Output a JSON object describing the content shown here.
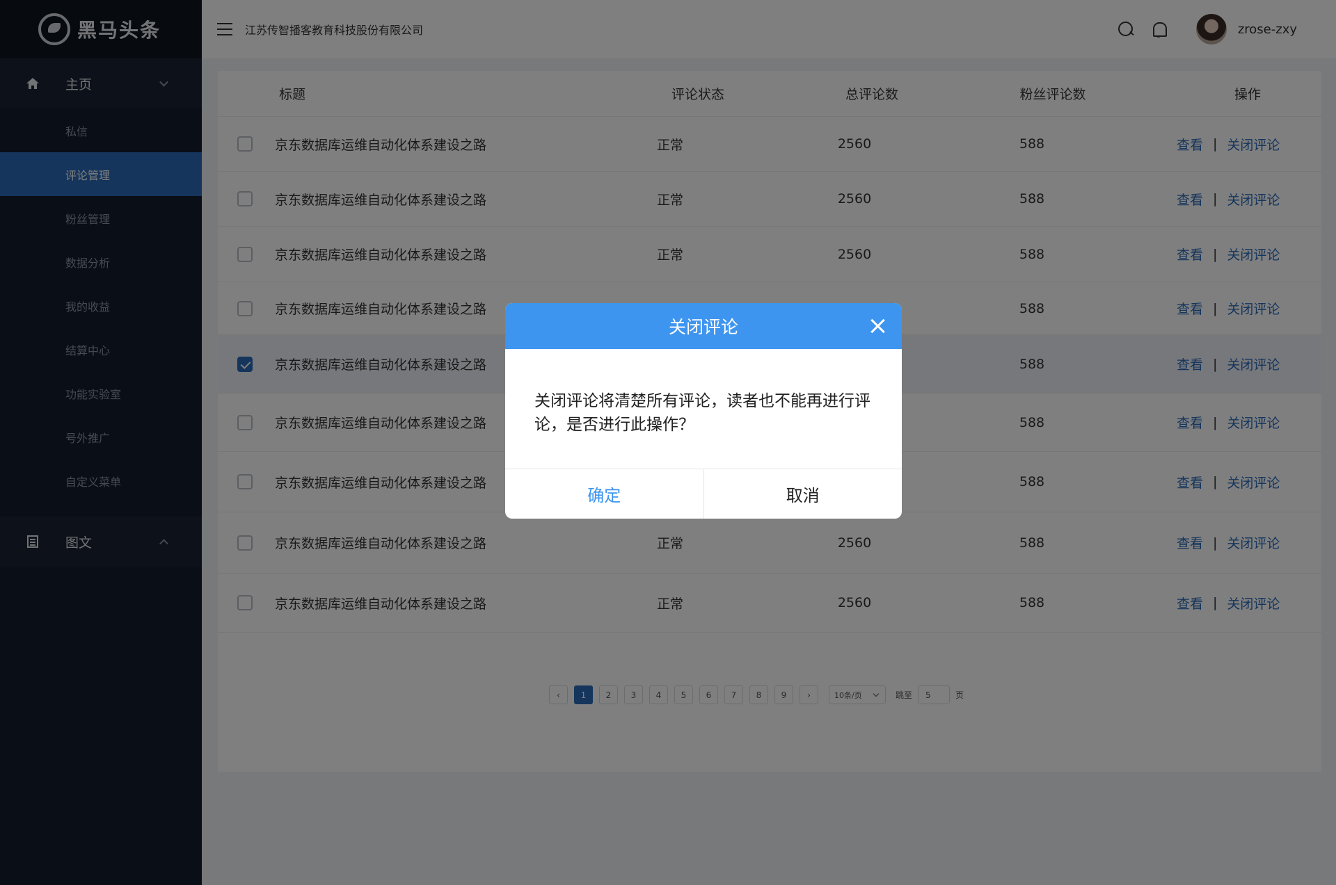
{
  "brand": {
    "name": "黑马头条"
  },
  "header": {
    "company": "江苏传智播客教育科技股份有限公司",
    "username": "zrose-zxy"
  },
  "sidebar": {
    "group1": {
      "label": "主页"
    },
    "items": [
      {
        "label": "私信"
      },
      {
        "label": "评论管理"
      },
      {
        "label": "粉丝管理"
      },
      {
        "label": "数据分析"
      },
      {
        "label": "我的收益"
      },
      {
        "label": "结算中心"
      },
      {
        "label": "功能实验室"
      },
      {
        "label": "号外推广"
      },
      {
        "label": "自定义菜单"
      }
    ],
    "group2": {
      "label": "图文"
    }
  },
  "table": {
    "headers": {
      "title": "标题",
      "status": "评论状态",
      "total": "总评论数",
      "fans": "粉丝评论数",
      "ops": "操作"
    },
    "rows": [
      {
        "title": "京东数据库运维自动化体系建设之路",
        "status": "正常",
        "total": "2560",
        "fans": "588",
        "view": "查看",
        "sep": "|",
        "close": "关闭评论"
      },
      {
        "title": "京东数据库运维自动化体系建设之路",
        "status": "正常",
        "total": "2560",
        "fans": "588",
        "view": "查看",
        "sep": "|",
        "close": "关闭评论"
      },
      {
        "title": "京东数据库运维自动化体系建设之路",
        "status": "正常",
        "total": "2560",
        "fans": "588",
        "view": "查看",
        "sep": "|",
        "close": "关闭评论"
      },
      {
        "title": "京东数据库运维自动化体系建设之路",
        "status": "",
        "total": "",
        "fans": "588",
        "view": "查看",
        "sep": "|",
        "close": "关闭评论"
      },
      {
        "title": "京东数据库运维自动化体系建设之路",
        "status": "",
        "total": "",
        "fans": "588",
        "view": "查看",
        "sep": "|",
        "close": "关闭评论"
      },
      {
        "title": "京东数据库运维自动化体系建设之路",
        "status": "",
        "total": "",
        "fans": "588",
        "view": "查看",
        "sep": "|",
        "close": "关闭评论"
      },
      {
        "title": "京东数据库运维自动化体系建设之路",
        "status": "",
        "total": "",
        "fans": "588",
        "view": "查看",
        "sep": "|",
        "close": "关闭评论"
      },
      {
        "title": "京东数据库运维自动化体系建设之路",
        "status": "正常",
        "total": "2560",
        "fans": "588",
        "view": "查看",
        "sep": "|",
        "close": "关闭评论"
      },
      {
        "title": "京东数据库运维自动化体系建设之路",
        "status": "正常",
        "total": "2560",
        "fans": "588",
        "view": "查看",
        "sep": "|",
        "close": "关闭评论"
      }
    ]
  },
  "pagination": {
    "pages": [
      "1",
      "2",
      "3",
      "4",
      "5",
      "6",
      "7",
      "8",
      "9"
    ],
    "prev": "‹",
    "next": "›",
    "page_size": "10条/页",
    "jump_label": "跳至",
    "jump_value": "5",
    "page_label": "页"
  },
  "modal": {
    "title": "关闭评论",
    "message": "关闭评论将清楚所有评论，读者也不能再进行评论，是否进行此操作？",
    "confirm": "确定",
    "cancel": "取消"
  },
  "colors": {
    "primary": "#2a6ab8",
    "modal_header": "#3d95ef",
    "sidebar_bg": "#151c2c"
  }
}
